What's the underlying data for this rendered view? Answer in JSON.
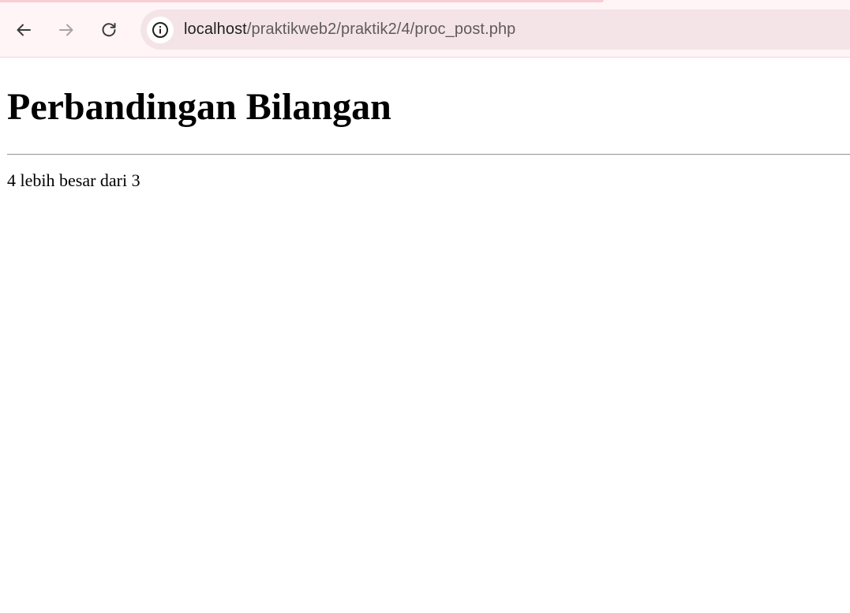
{
  "browser": {
    "url_host": "localhost",
    "url_path": "/praktikweb2/praktik2/4/proc_post.php",
    "accent_colors": {
      "toolbar_bg": "#fff5f6",
      "omnibox_bg": "#f4e4e8",
      "tab_edge": "#f8cdd3"
    },
    "icons": [
      "back-arrow-icon",
      "forward-arrow-icon",
      "reload-icon",
      "site-info-icon"
    ]
  },
  "page": {
    "title": "Perbandingan Bilangan",
    "result_text": "4 lebih besar dari 3"
  }
}
